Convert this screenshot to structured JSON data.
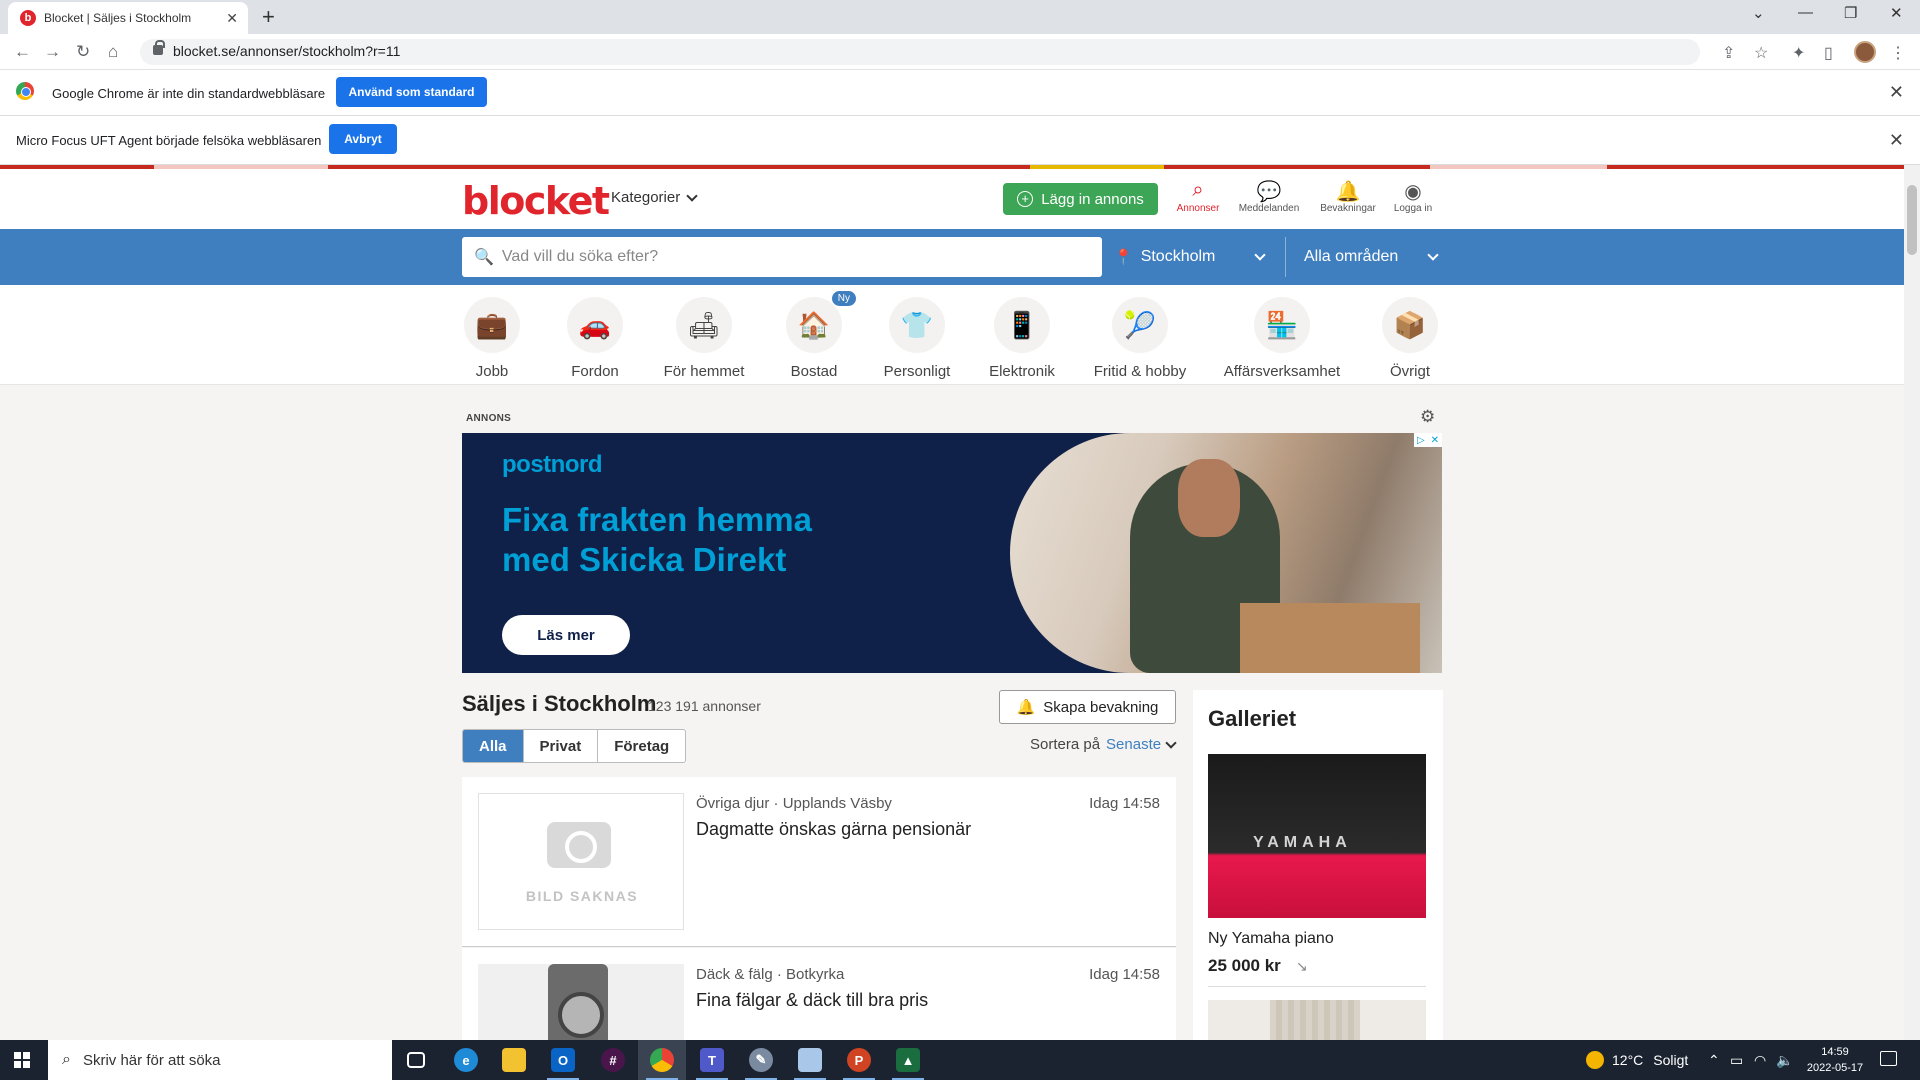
{
  "browser": {
    "tab_title": "Blocket | Säljes i Stockholm",
    "favicon_letter": "b",
    "url": "blocket.se/annonser/stockholm?r=11",
    "infobar1": {
      "message": "Google Chrome är inte din standardwebbläsare",
      "button": "Använd som standard"
    },
    "infobar2": {
      "message": "Micro Focus UFT Agent började felsöka webbläsaren",
      "button": "Avbryt"
    }
  },
  "site": {
    "logo": "blocket",
    "categories_menu": "Kategorier",
    "post_button": "Lägg in annons",
    "header_items": [
      {
        "label": "Annonser",
        "icon": "search-icon"
      },
      {
        "label": "Meddelanden",
        "icon": "chat-icon"
      },
      {
        "label": "Bevakningar",
        "icon": "bell-icon"
      },
      {
        "label": "Logga in",
        "icon": "user-icon"
      }
    ],
    "search_placeholder": "Vad vill du söka efter?",
    "location": "Stockholm",
    "area": "Alla områden"
  },
  "categories": [
    {
      "label": "Jobb",
      "icon": "briefcase-icon"
    },
    {
      "label": "Fordon",
      "icon": "car-icon"
    },
    {
      "label": "För hemmet",
      "icon": "sofa-icon"
    },
    {
      "label": "Bostad",
      "icon": "house-icon",
      "badge": "Ny"
    },
    {
      "label": "Personligt",
      "icon": "tshirt-icon"
    },
    {
      "label": "Elektronik",
      "icon": "phone-icon"
    },
    {
      "label": "Fritid & hobby",
      "icon": "racket-icon"
    },
    {
      "label": "Affärsverksamhet",
      "icon": "store-icon"
    },
    {
      "label": "Övrigt",
      "icon": "box-icon"
    }
  ],
  "ad": {
    "label": "ANNONS",
    "brand": "postnord",
    "headline_line1": "Fixa frakten hemma",
    "headline_line2": "med Skicka Direkt",
    "cta": "Läs mer"
  },
  "listings_header": {
    "title": "Säljes i Stockholm",
    "count": "123 191 annonser",
    "watch_button": "Skapa bevakning",
    "tabs": [
      "Alla",
      "Privat",
      "Företag"
    ],
    "sort_label": "Sortera på",
    "sort_value": "Senaste"
  },
  "listings": [
    {
      "meta": "Övriga djur · Upplands Väsby",
      "time": "Idag 14:58",
      "title": "Dagmatte önskas gärna pensionär",
      "image_missing_text": "BILD SAKNAS"
    },
    {
      "meta": "Däck & fälg · Botkyrka",
      "time": "Idag 14:58",
      "title": "Fina fälgar & däck till bra pris"
    }
  ],
  "gallery": {
    "title": "Galleriet",
    "image_text": "YAMAHA",
    "item_name": "Ny Yamaha piano",
    "item_price": "25 000 kr"
  },
  "taskbar": {
    "search_placeholder": "Skriv här för att söka",
    "weather_temp": "12°C",
    "weather_text": "Soligt",
    "time": "14:59",
    "date": "2022-05-17"
  }
}
